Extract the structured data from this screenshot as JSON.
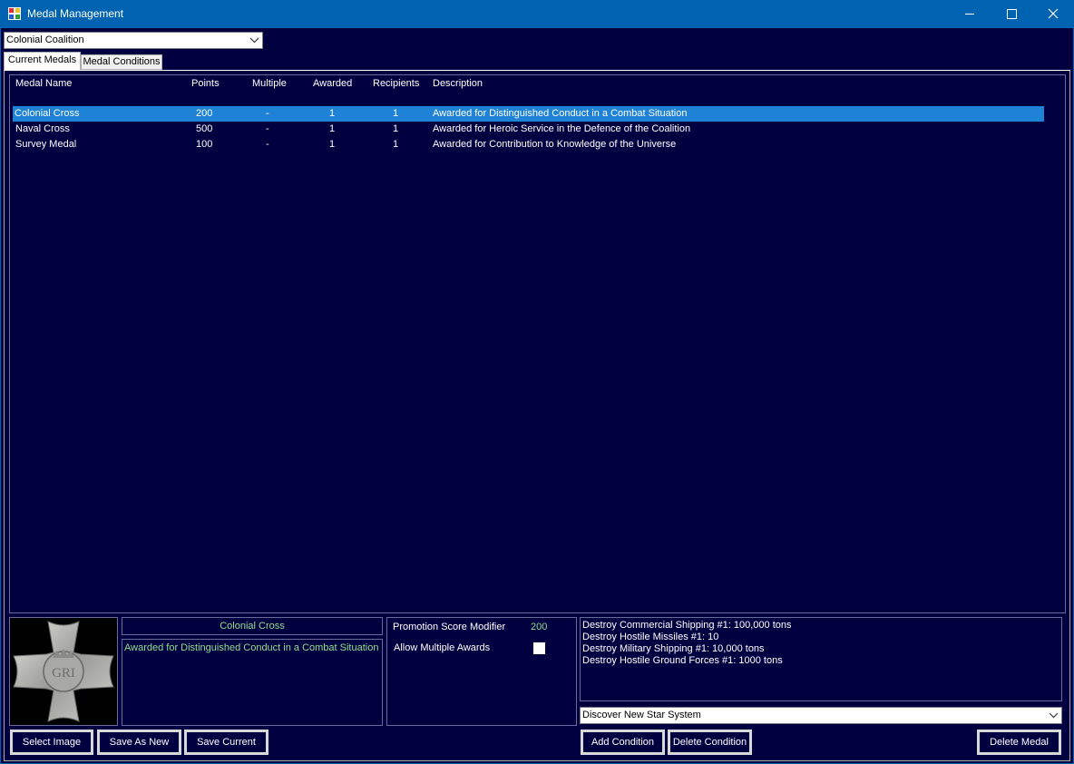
{
  "window": {
    "title": "Medal Management"
  },
  "race_select": {
    "value": "Colonial Coalition"
  },
  "tabs": [
    {
      "label": "Current Medals"
    },
    {
      "label": "Medal Conditions"
    }
  ],
  "table": {
    "headers": [
      "Medal Name",
      "Points",
      "Multiple",
      "Awarded",
      "Recipients",
      "Description"
    ],
    "rows": [
      {
        "name": "Colonial Cross",
        "points": "200",
        "multiple": "-",
        "awarded": "1",
        "recipients": "1",
        "description": "Awarded for Distinguished Conduct in a Combat Situation"
      },
      {
        "name": "Naval Cross",
        "points": "500",
        "multiple": "-",
        "awarded": "1",
        "recipients": "1",
        "description": "Awarded for Heroic Service in the Defence of the Coalition"
      },
      {
        "name": "Survey Medal",
        "points": "100",
        "multiple": "-",
        "awarded": "1",
        "recipients": "1",
        "description": "Awarded for Contribution to Knowledge of the Universe"
      }
    ]
  },
  "details": {
    "name": "Colonial Cross",
    "description": "Awarded for Distinguished Conduct in a Combat Situation",
    "promotion_label": "Promotion Score Modifier",
    "promotion_value": "200",
    "multiple_label": "Allow Multiple Awards",
    "medal_image_text": "GRI"
  },
  "conditions": [
    "Destroy Commercial Shipping #1:  100,000 tons",
    "Destroy Hostile Missiles #1:  10",
    "Destroy Military Shipping #1:  10,000 tons",
    "Destroy Hostile Ground Forces #1:  1000 tons"
  ],
  "condition_select": {
    "value": "Discover New Star System"
  },
  "buttons": {
    "select_image": "Select Image",
    "save_as_new": "Save As New",
    "save_current": "Save Current",
    "add_condition": "Add Condition",
    "delete_condition": "Delete Condition",
    "delete_medal": "Delete Medal"
  },
  "colors": {
    "background": "#000040",
    "titlebar": "#0063b1",
    "selection": "#1e82d7",
    "accent_text": "#8fe08f"
  }
}
